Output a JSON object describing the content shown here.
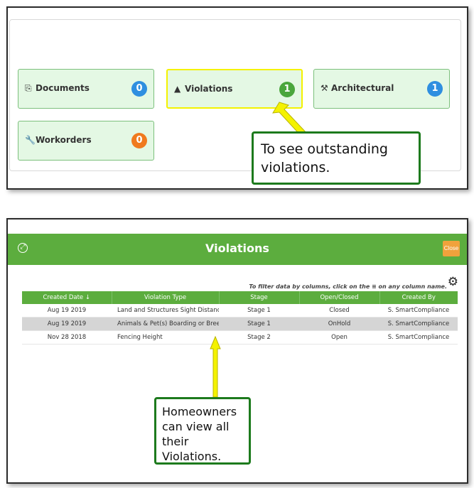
{
  "tiles": [
    {
      "icon": "documents-icon",
      "glyph": "⎘",
      "label": "Documents",
      "count": "0",
      "color": "#2f8fe0"
    },
    {
      "icon": "warning-icon",
      "glyph": "▲",
      "label": "Violations",
      "count": "1",
      "color": "#4aa63c"
    },
    {
      "icon": "hammer-icon",
      "glyph": "⚒",
      "label": "Architectural",
      "count": "1",
      "color": "#2f8fe0"
    },
    {
      "icon": "wrench-icon",
      "glyph": "🔧",
      "label": "Workorders",
      "count": "0",
      "color": "#f07a1e"
    }
  ],
  "callouts": {
    "top": "To see outstanding violations.",
    "bottom": "Homeowners can view all their Violations."
  },
  "modal": {
    "title": "Violations",
    "close_label": "Close",
    "filter_hint": "To filter data by columns, click on the ≡ on any column name.",
    "columns": [
      "Created Date ↓",
      "Violation Type",
      "Stage",
      "Open/Closed",
      "Created By"
    ],
    "rows": [
      [
        "Aug 19 2019",
        "Land and Structures Sight Distance",
        "Stage 1",
        "Closed",
        "S. SmartCompliance"
      ],
      [
        "Aug 19 2019",
        "Animals & Pet(s) Boarding or Breeding",
        "Stage 1",
        "OnHold",
        "S. SmartCompliance"
      ],
      [
        "Nov 28 2018",
        "Fencing Height",
        "Stage 2",
        "Open",
        "S. SmartCompliance"
      ]
    ]
  }
}
